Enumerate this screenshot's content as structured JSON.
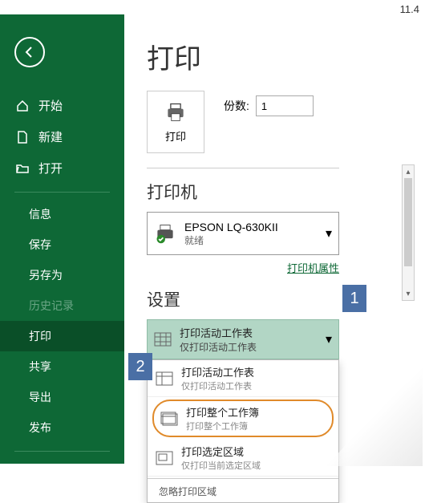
{
  "version": "11.4",
  "sidebar": {
    "items": [
      {
        "label": "开始",
        "icon": "home"
      },
      {
        "label": "新建",
        "icon": "file"
      },
      {
        "label": "打开",
        "icon": "folder"
      }
    ],
    "subItems": [
      {
        "label": "信息"
      },
      {
        "label": "保存"
      },
      {
        "label": "另存为"
      },
      {
        "label": "历史记录",
        "disabled": true
      },
      {
        "label": "打印",
        "active": true
      },
      {
        "label": "共享"
      },
      {
        "label": "导出"
      },
      {
        "label": "发布"
      }
    ]
  },
  "page": {
    "title": "打印",
    "printButton": "打印",
    "copiesLabel": "份数:",
    "copiesValue": "1",
    "printerSection": "打印机",
    "printer": {
      "name": "EPSON LQ-630KII",
      "status": "就绪"
    },
    "printerProps": "打印机属性",
    "settingsSection": "设置",
    "selected": {
      "line1": "打印活动工作表",
      "line2": "仅打印活动工作表"
    },
    "menu": [
      {
        "line1": "打印活动工作表",
        "line2": "仅打印活动工作表"
      },
      {
        "line1": "打印整个工作簿",
        "line2": "打印整个工作簿",
        "highlight": true
      },
      {
        "line1": "打印选定区域",
        "line2": "仅打印当前选定区域"
      }
    ],
    "menuFooter": "忽略打印区域"
  },
  "callouts": {
    "c1": "1",
    "c2": "2"
  }
}
